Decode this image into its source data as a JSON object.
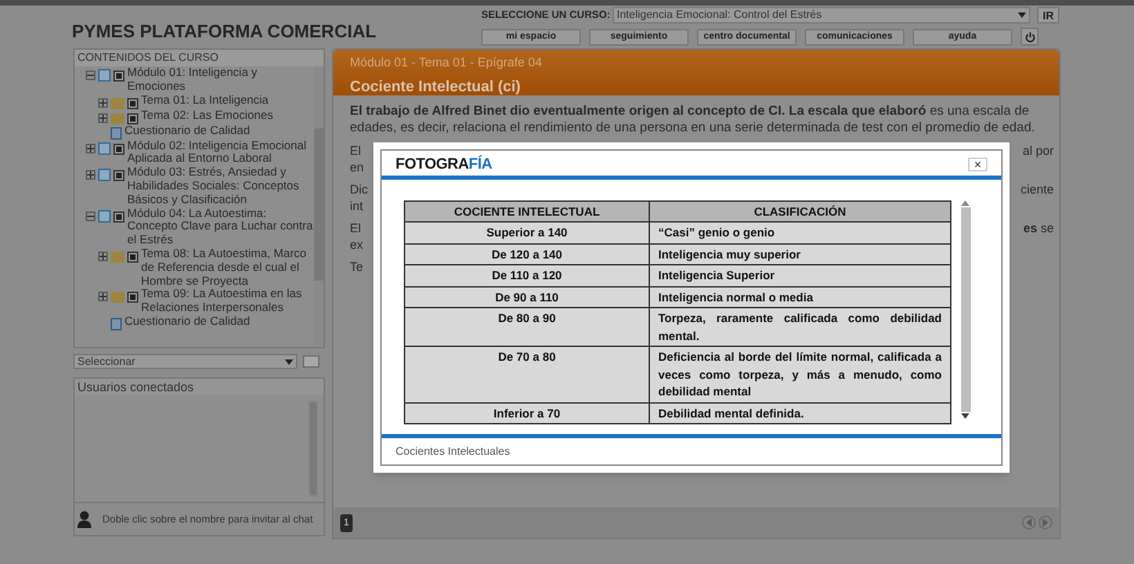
{
  "header": {
    "title": "PYMES PLATAFORMA COMERCIAL",
    "course_label": "SELECCIONE UN CURSO:",
    "course_value": "Inteligencia Emocional: Control del Estrés",
    "go_button": "IR",
    "nav": [
      "mi espacio",
      "seguimiento",
      "centro documental",
      "comunicaciones",
      "ayuda"
    ]
  },
  "sidebar": {
    "title": "CONTENIDOS DEL CURSO",
    "tree": [
      {
        "kind": "module",
        "label": "Módulo 01: Inteligencia y Emociones",
        "checked": true,
        "expanded": true,
        "children": [
          {
            "kind": "topic",
            "label": "Tema 01: La Inteligencia",
            "checked": true,
            "expanded": false
          },
          {
            "kind": "topic",
            "label": "Tema 02: Las Emociones",
            "checked": true,
            "expanded": false
          },
          {
            "kind": "quiz",
            "label": "Cuestionario de Calidad"
          }
        ]
      },
      {
        "kind": "module",
        "label": "Módulo 02: Inteligencia Emocional Aplicada al Entorno Laboral",
        "checked": true,
        "expanded": false
      },
      {
        "kind": "module",
        "label": "Módulo 03: Estrés, Ansiedad y Habilidades Sociales: Conceptos Básicos y Clasificación",
        "checked": true,
        "expanded": false
      },
      {
        "kind": "module",
        "label": "Módulo 04: La Autoestima: Concepto Clave para Luchar contra el Estrés",
        "checked": true,
        "expanded": true,
        "children": [
          {
            "kind": "topic",
            "label": "Tema 08: La Autoestima, Marco de Referencia desde el cual el Hombre se Proyecta",
            "checked": true,
            "expanded": false
          },
          {
            "kind": "topic",
            "label": "Tema 09: La Autoestima en las Relaciones Interpersonales",
            "checked": true,
            "expanded": false
          },
          {
            "kind": "quiz",
            "label": "Cuestionario de Calidad"
          }
        ]
      }
    ],
    "select_value": "Seleccionar"
  },
  "users_panel": {
    "title": "Usuarios conectados",
    "hint": "Doble clic sobre el nombre para invitar al chat"
  },
  "content": {
    "breadcrumb": "Módulo 01 - Tema 01 - Epígrafe 04",
    "title": "Cociente Intelectual (ci)",
    "intro": "**El trabajo de Alfred Binet dio eventualmente origen al concepto de CI. La escala que elaboró** es una escala de edades, es decir, relaciona el rendimiento de una persona en una serie determinada de test con el promedio de edad.",
    "hidden_paragraphs": [
      [
        {
          "left": "El",
          "right": "al por"
        },
        {
          "left": "en"
        }
      ],
      [
        {
          "left": "Dic",
          "right": "ciente"
        },
        {
          "left": "int"
        }
      ],
      [
        {
          "left": "El",
          "right": "**es** se"
        },
        {
          "left": "ex"
        }
      ],
      [
        {
          "left": "Te"
        }
      ]
    ],
    "page_number": "1"
  },
  "modal": {
    "logo_main": "FOTOGRA",
    "logo_accent": "FÍA",
    "close": "×",
    "table": {
      "columns": [
        "COCIENTE INTELECTUAL",
        "CLASIFICACIÓN"
      ],
      "rows": [
        [
          "Superior a 140",
          "“Casi” genio o genio"
        ],
        [
          "De 120 a 140",
          "Inteligencia muy superior"
        ],
        [
          "De 110 a 120",
          "Inteligencia Superior"
        ],
        [
          "De 90 a 110",
          "Inteligencia normal o media"
        ],
        [
          "De 80 a 90",
          "Torpeza, raramente calificada como debilidad mental."
        ],
        [
          "De 70 a 80",
          "Deficiencia al borde del límite normal, calificada a veces como torpeza, y más a menudo, como debilidad mental"
        ],
        [
          "Inferior a 70",
          "Debilidad mental definida."
        ]
      ]
    },
    "caption": "Cocientes Intelectuales"
  }
}
